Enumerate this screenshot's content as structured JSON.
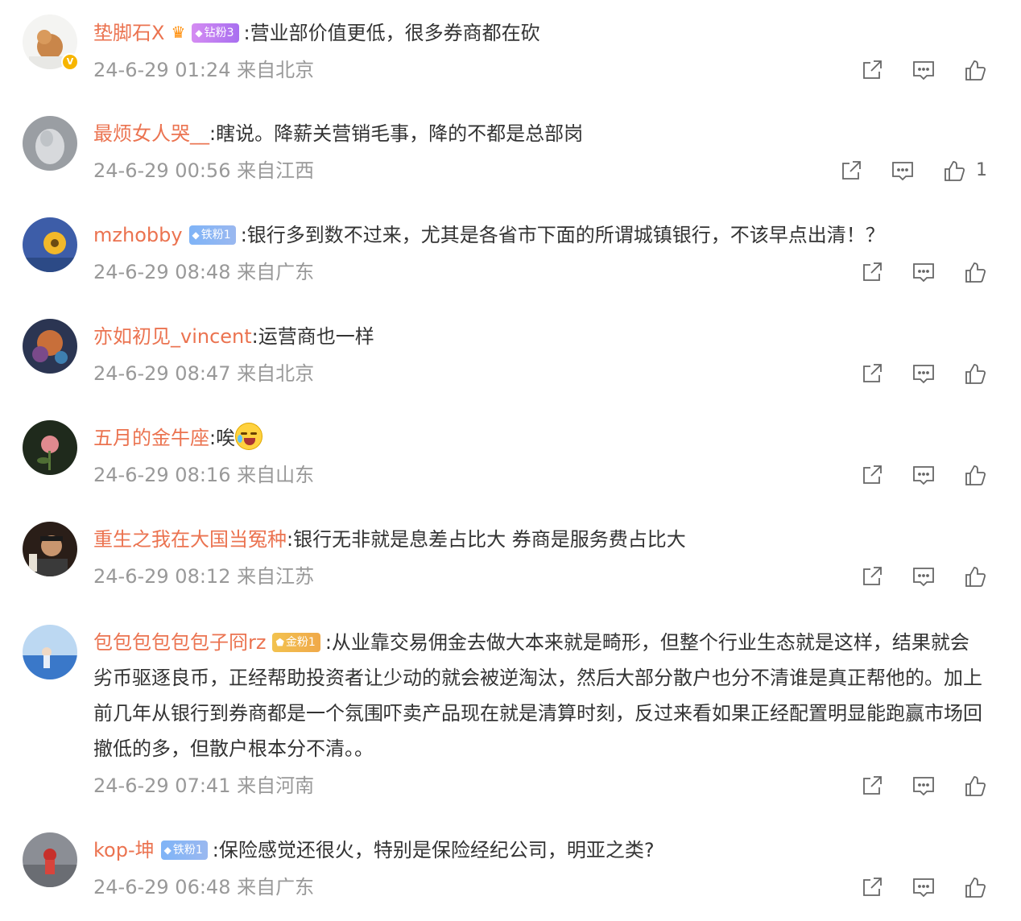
{
  "comments": [
    {
      "user": "垫脚石X",
      "badge": "钻粉3",
      "badge_type": "diamond",
      "crown": true,
      "verified": true,
      "text": ":营业部价值更低，很多券商都在砍",
      "time": "24-6-29 01:24",
      "location": "来自北京",
      "likes": ""
    },
    {
      "user": "最烦女人哭__",
      "badge": "",
      "text": ":瞎说。降薪关营销毛事，降的不都是总部岗",
      "time": "24-6-29 00:56",
      "location": "来自江西",
      "likes": "1"
    },
    {
      "user": "mzhobby",
      "badge": "铁粉1",
      "badge_type": "iron",
      "text": ":银行多到数不过来，尤其是各省市下面的所谓城镇银行，不该早点出清！？",
      "time": "24-6-29 08:48",
      "location": "来自广东",
      "likes": ""
    },
    {
      "user": "亦如初见_vincent",
      "badge": "",
      "text": ":运营商也一样",
      "time": "24-6-29 08:47",
      "location": "来自北京",
      "likes": ""
    },
    {
      "user": "五月的金牛座",
      "badge": "",
      "text": ":唉",
      "emoji": true,
      "time": "24-6-29 08:16",
      "location": "来自山东",
      "likes": ""
    },
    {
      "user": "重生之我在大国当冤种",
      "badge": "",
      "text": ":银行无非就是息差占比大 券商是服务费占比大",
      "time": "24-6-29 08:12",
      "location": "来自江苏",
      "likes": ""
    },
    {
      "user": "包包包包包包子冏rz",
      "badge": "金粉1",
      "badge_type": "gold",
      "text": ":从业靠交易佣金去做大本来就是畸形，但整个行业生态就是这样，结果就会劣币驱逐良币，正经帮助投资者让少动的就会被逆淘汰，然后大部分散户也分不清谁是真正帮他的。加上前几年从银行到券商都是一个氛围吓卖产品现在就是清算时刻，反过来看如果正经配置明显能跑赢市场回撤低的多，但散户根本分不清。。",
      "time": "24-6-29 07:41",
      "location": "来自河南",
      "likes": ""
    },
    {
      "user": "kop-坤",
      "badge": "铁粉1",
      "badge_type": "iron",
      "text": ":保险感觉还很火，特别是保险经纪公司，明亚之类?",
      "time": "24-6-29 06:48",
      "location": "来自广东",
      "likes": ""
    }
  ],
  "colors": {
    "username": "#eb7350",
    "text": "#333333",
    "meta": "#999999",
    "icon": "#666666"
  },
  "icons": [
    "share-icon",
    "comment-icon",
    "like-icon",
    "verified-icon",
    "crown-icon"
  ]
}
